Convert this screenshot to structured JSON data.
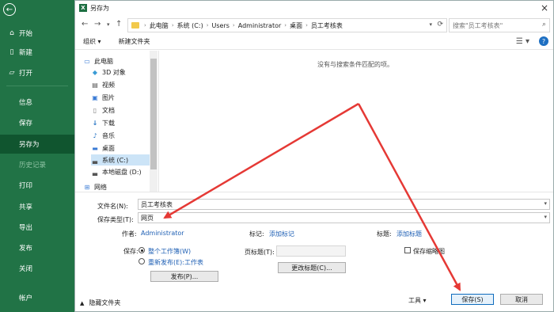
{
  "sidebar": {
    "back_icon": "arrow-left-icon",
    "items": [
      {
        "label": "开始",
        "icon": "home-icon"
      },
      {
        "label": "新建",
        "icon": "new-doc-icon"
      },
      {
        "label": "打开",
        "icon": "folder-open-icon"
      },
      {
        "label": "信息"
      },
      {
        "label": "保存"
      },
      {
        "label": "另存为"
      },
      {
        "label": "历史记录"
      },
      {
        "label": "打印"
      },
      {
        "label": "共享"
      },
      {
        "label": "导出"
      },
      {
        "label": "发布"
      },
      {
        "label": "关闭"
      },
      {
        "label": "帐户"
      }
    ],
    "accent": "#217346"
  },
  "dialog": {
    "title": "另存为",
    "breadcrumb": [
      "此电脑",
      "系统 (C:)",
      "Users",
      "Administrator",
      "桌面",
      "员工考核表"
    ],
    "search_placeholder": "搜索\"员工考核表\"",
    "toolbar": {
      "organize": "组织 ▾",
      "new_folder": "新建文件夹"
    },
    "nav_tree": [
      {
        "label": "此电脑",
        "icon": "computer-icon"
      },
      {
        "label": "3D 对象",
        "icon": "cube-icon"
      },
      {
        "label": "视频",
        "icon": "video-icon"
      },
      {
        "label": "图片",
        "icon": "picture-icon"
      },
      {
        "label": "文档",
        "icon": "document-icon"
      },
      {
        "label": "下载",
        "icon": "download-icon"
      },
      {
        "label": "音乐",
        "icon": "music-icon"
      },
      {
        "label": "桌面",
        "icon": "desktop-icon"
      },
      {
        "label": "系统 (C:)",
        "icon": "drive-icon"
      },
      {
        "label": "本地磁盘 (D:)",
        "icon": "drive-icon"
      },
      {
        "label": "网络",
        "icon": "network-icon"
      }
    ],
    "empty_message": "没有与搜索条件匹配的项。",
    "filename_label": "文件名(N):",
    "filename_value": "员工考核表",
    "savetype_label": "保存类型(T):",
    "savetype_value": "网页",
    "author_label": "作者:",
    "author_value": "Administrator",
    "tags_label": "标记:",
    "tags_value": "添加标记",
    "title_label": "标题:",
    "title_value": "添加标题",
    "save_label": "保存:",
    "save_option1": "整个工作簿(W)",
    "save_option2": "重新发布(E):工作表",
    "page_title_label": "页标题(T):",
    "change_title_button": "更改标题(C)...",
    "save_thumbnail": "保存缩略图",
    "publish_button": "发布(P)...",
    "hide_folders": "隐藏文件夹",
    "tools": "工具",
    "save_button": "保存(S)",
    "cancel_button": "取消"
  },
  "annotation": {
    "arrow_color": "#e53935"
  }
}
